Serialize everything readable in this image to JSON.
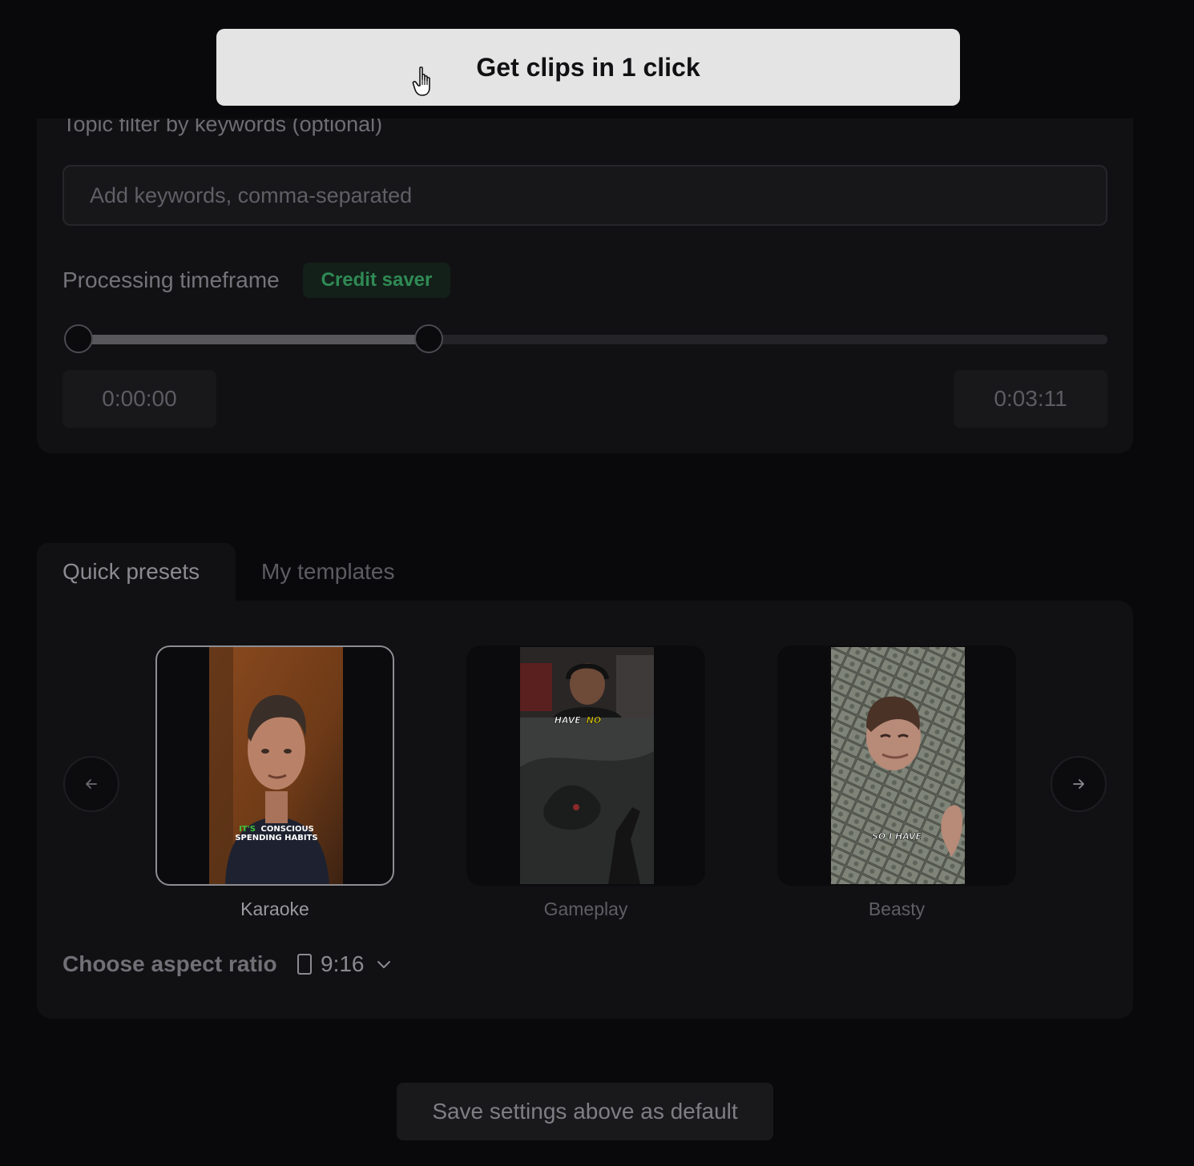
{
  "cta": {
    "label": "Get clips in 1 click"
  },
  "topic_filter": {
    "label": "Topic filter by keywords (optional)",
    "input_value": "",
    "placeholder": "Add keywords, comma-separated"
  },
  "timeframe": {
    "label": "Processing timeframe",
    "badge": "Credit saver",
    "start_time": "0:00:00",
    "end_time": "0:03:11",
    "selected_fraction_start": 0.0,
    "selected_fraction_end": 0.335
  },
  "tabs": [
    {
      "label": "Quick presets",
      "active": true
    },
    {
      "label": "My templates",
      "active": false
    }
  ],
  "presets": [
    {
      "name": "Karaoke",
      "caption_highlight": "IT'S",
      "caption_rest": "CONSCIOUS",
      "caption_line2": "SPENDING HABITS",
      "selected": true
    },
    {
      "name": "Gameplay",
      "caption_word1": "HAVE",
      "caption_word2": "NO",
      "selected": false
    },
    {
      "name": "Beasty",
      "caption": "SO I HAVE",
      "selected": false
    }
  ],
  "aspect_ratio": {
    "label": "Choose aspect ratio",
    "value": "9:16"
  },
  "save_default": {
    "label": "Save settings above as default"
  },
  "icons": {
    "cursor": "hand-pointer-icon",
    "prev": "arrow-left-icon",
    "next": "arrow-right-icon",
    "aspect": "phone-portrait-icon",
    "dropdown": "chevron-down-icon"
  },
  "colors": {
    "cta_bg": "#e4e4e4",
    "badge_text": "#2f8a55",
    "karaoke_highlight": "#3ec23e",
    "gameplay_highlight": "#e8d21a"
  }
}
